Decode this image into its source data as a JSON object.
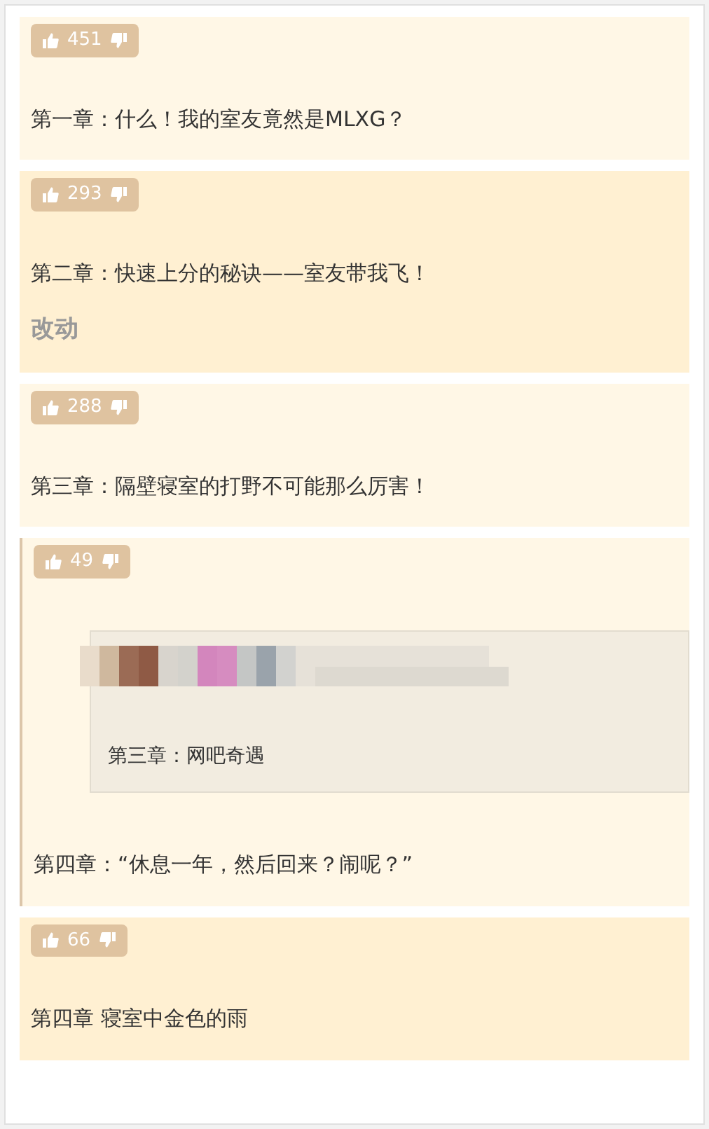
{
  "posts": [
    {
      "votes": "451",
      "highlighted": false,
      "text": "第一章：什么！我的室友竟然是MLXG？"
    },
    {
      "votes": "293",
      "highlighted": true,
      "text": "第二章：快速上分的秘诀——室友带我飞！",
      "note": "改动"
    },
    {
      "votes": "288",
      "highlighted": false,
      "text": "第三章：隔壁寝室的打野不可能那么厉害！"
    },
    {
      "votes": "49",
      "highlighted": false,
      "quote": {
        "text": "第三章：网吧奇遇"
      },
      "text": "第四章：“休息一年，然后回来？闹呢？”"
    },
    {
      "votes": "66",
      "highlighted": true,
      "text": "第四章 寝室中金色的雨"
    }
  ]
}
